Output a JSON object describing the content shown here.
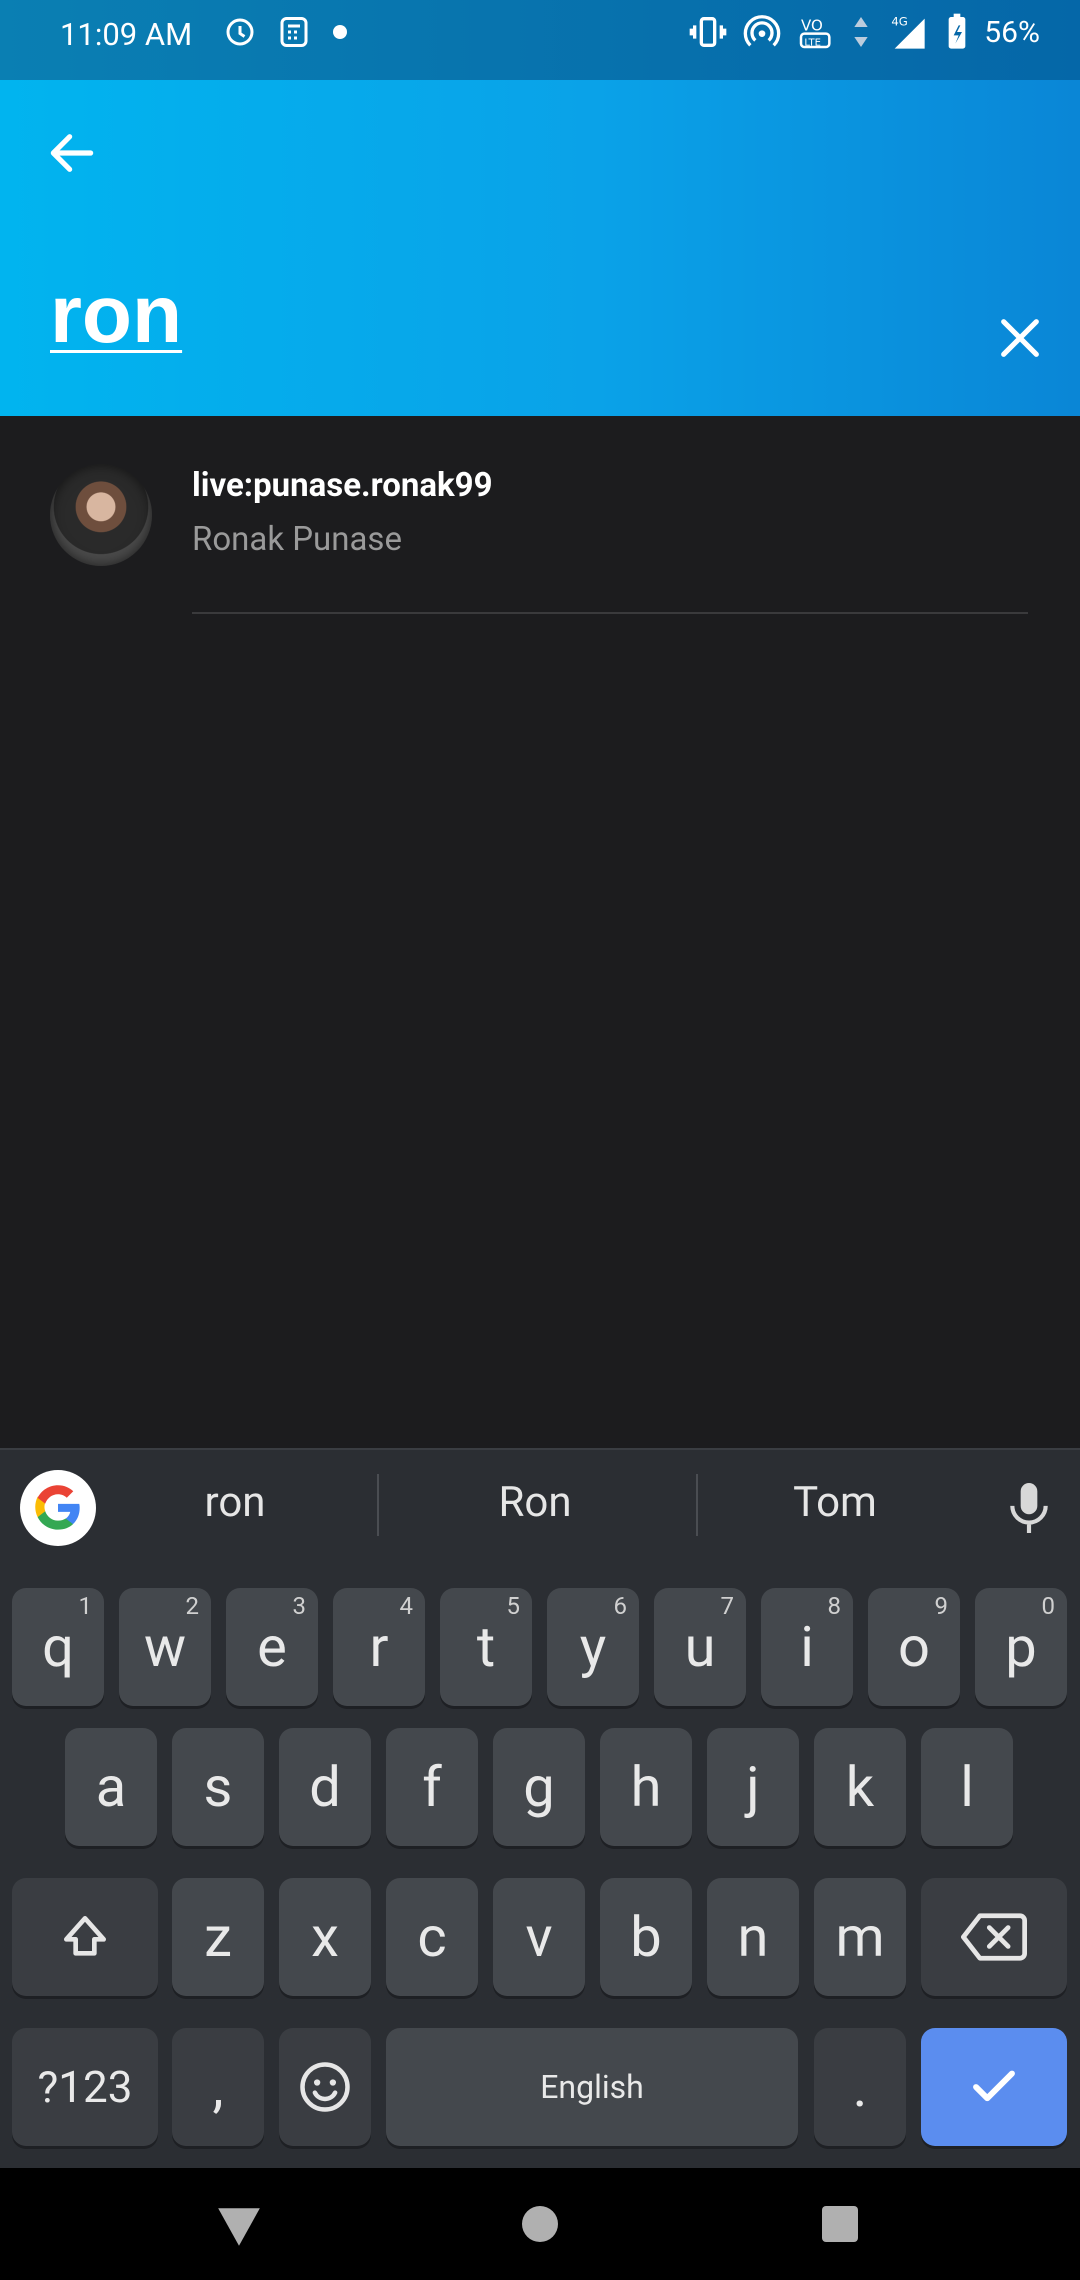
{
  "status_bar": {
    "time": "11:09 AM",
    "battery_percent": "56%",
    "network": "4G",
    "icons_left": [
      "sync-icon",
      "calculator-icon",
      "dot-icon"
    ],
    "icons_right": [
      "vibrate-icon",
      "hotspot-icon",
      "volte-icon",
      "data-arrows-icon",
      "signal-icon",
      "battery-icon"
    ]
  },
  "search": {
    "query": "ron",
    "back_icon": "arrow-back-icon",
    "clear_icon": "close-icon"
  },
  "results": [
    {
      "title": "live:punase.ronak99",
      "subtitle": "Ronak Punase"
    }
  ],
  "keyboard": {
    "suggestions": [
      "ron",
      "Ron",
      "Tom"
    ],
    "row1": [
      {
        "key": "q",
        "num": "1"
      },
      {
        "key": "w",
        "num": "2"
      },
      {
        "key": "e",
        "num": "3"
      },
      {
        "key": "r",
        "num": "4"
      },
      {
        "key": "t",
        "num": "5"
      },
      {
        "key": "y",
        "num": "6"
      },
      {
        "key": "u",
        "num": "7"
      },
      {
        "key": "i",
        "num": "8"
      },
      {
        "key": "o",
        "num": "9"
      },
      {
        "key": "p",
        "num": "0"
      }
    ],
    "row2": [
      "a",
      "s",
      "d",
      "f",
      "g",
      "h",
      "j",
      "k",
      "l"
    ],
    "row3": [
      "z",
      "x",
      "c",
      "v",
      "b",
      "n",
      "m"
    ],
    "symbols_label": "?123",
    "comma_label": ",",
    "space_label": "English",
    "period_label": ".",
    "accent_color": "#5b8def"
  }
}
